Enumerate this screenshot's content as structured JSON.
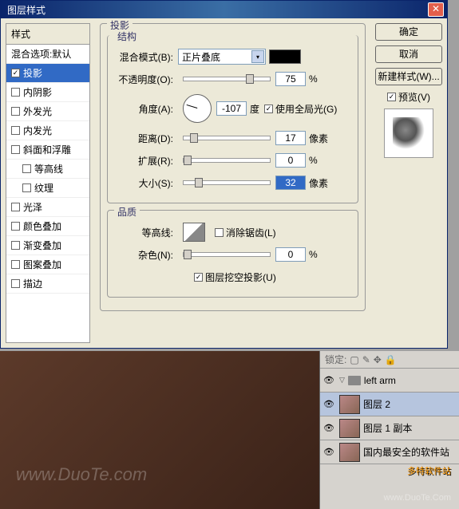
{
  "dialog": {
    "title": "图层样式",
    "leftHeader": "样式",
    "blendOptions": "混合选项:默认",
    "effects": {
      "dropShadow": "投影",
      "innerShadow": "内阴影",
      "outerGlow": "外发光",
      "innerGlow": "内发光",
      "bevel": "斜面和浮雕",
      "contour": "等高线",
      "texture": "纹理",
      "satin": "光泽",
      "colorOverlay": "颜色叠加",
      "gradientOverlay": "渐变叠加",
      "patternOverlay": "图案叠加",
      "stroke": "描边"
    },
    "sections": {
      "shadow": "投影",
      "structure": "结构",
      "quality": "品质"
    },
    "labels": {
      "blendMode": "混合模式(B):",
      "opacity": "不透明度(O):",
      "angle": "角度(A):",
      "distance": "距离(D):",
      "spread": "扩展(R):",
      "size": "大小(S):",
      "contour": "等高线:",
      "noise": "杂色(N):",
      "antialias": "消除锯齿(L)",
      "globalLight": "使用全局光(G)",
      "knockout": "图层挖空投影(U)",
      "degree": "度",
      "pixel": "像素",
      "percent": "%"
    },
    "values": {
      "blendMode": "正片叠底",
      "opacity": "75",
      "angle": "-107",
      "distance": "17",
      "spread": "0",
      "size": "32",
      "noise": "0"
    },
    "buttons": {
      "ok": "确定",
      "cancel": "取消",
      "newStyle": "新建样式(W)...",
      "preview": "预览(V)"
    }
  },
  "layers": {
    "lock": "锁定:",
    "group": "left arm",
    "layer2": "图层 2",
    "layer1copy": "图层 1 副本"
  },
  "watermarks": {
    "duote": "www.DuoTe.com",
    "soft": "多特软件站",
    "safe": "国内最安全的软件站",
    "url": "www.DuoTe.Com"
  }
}
